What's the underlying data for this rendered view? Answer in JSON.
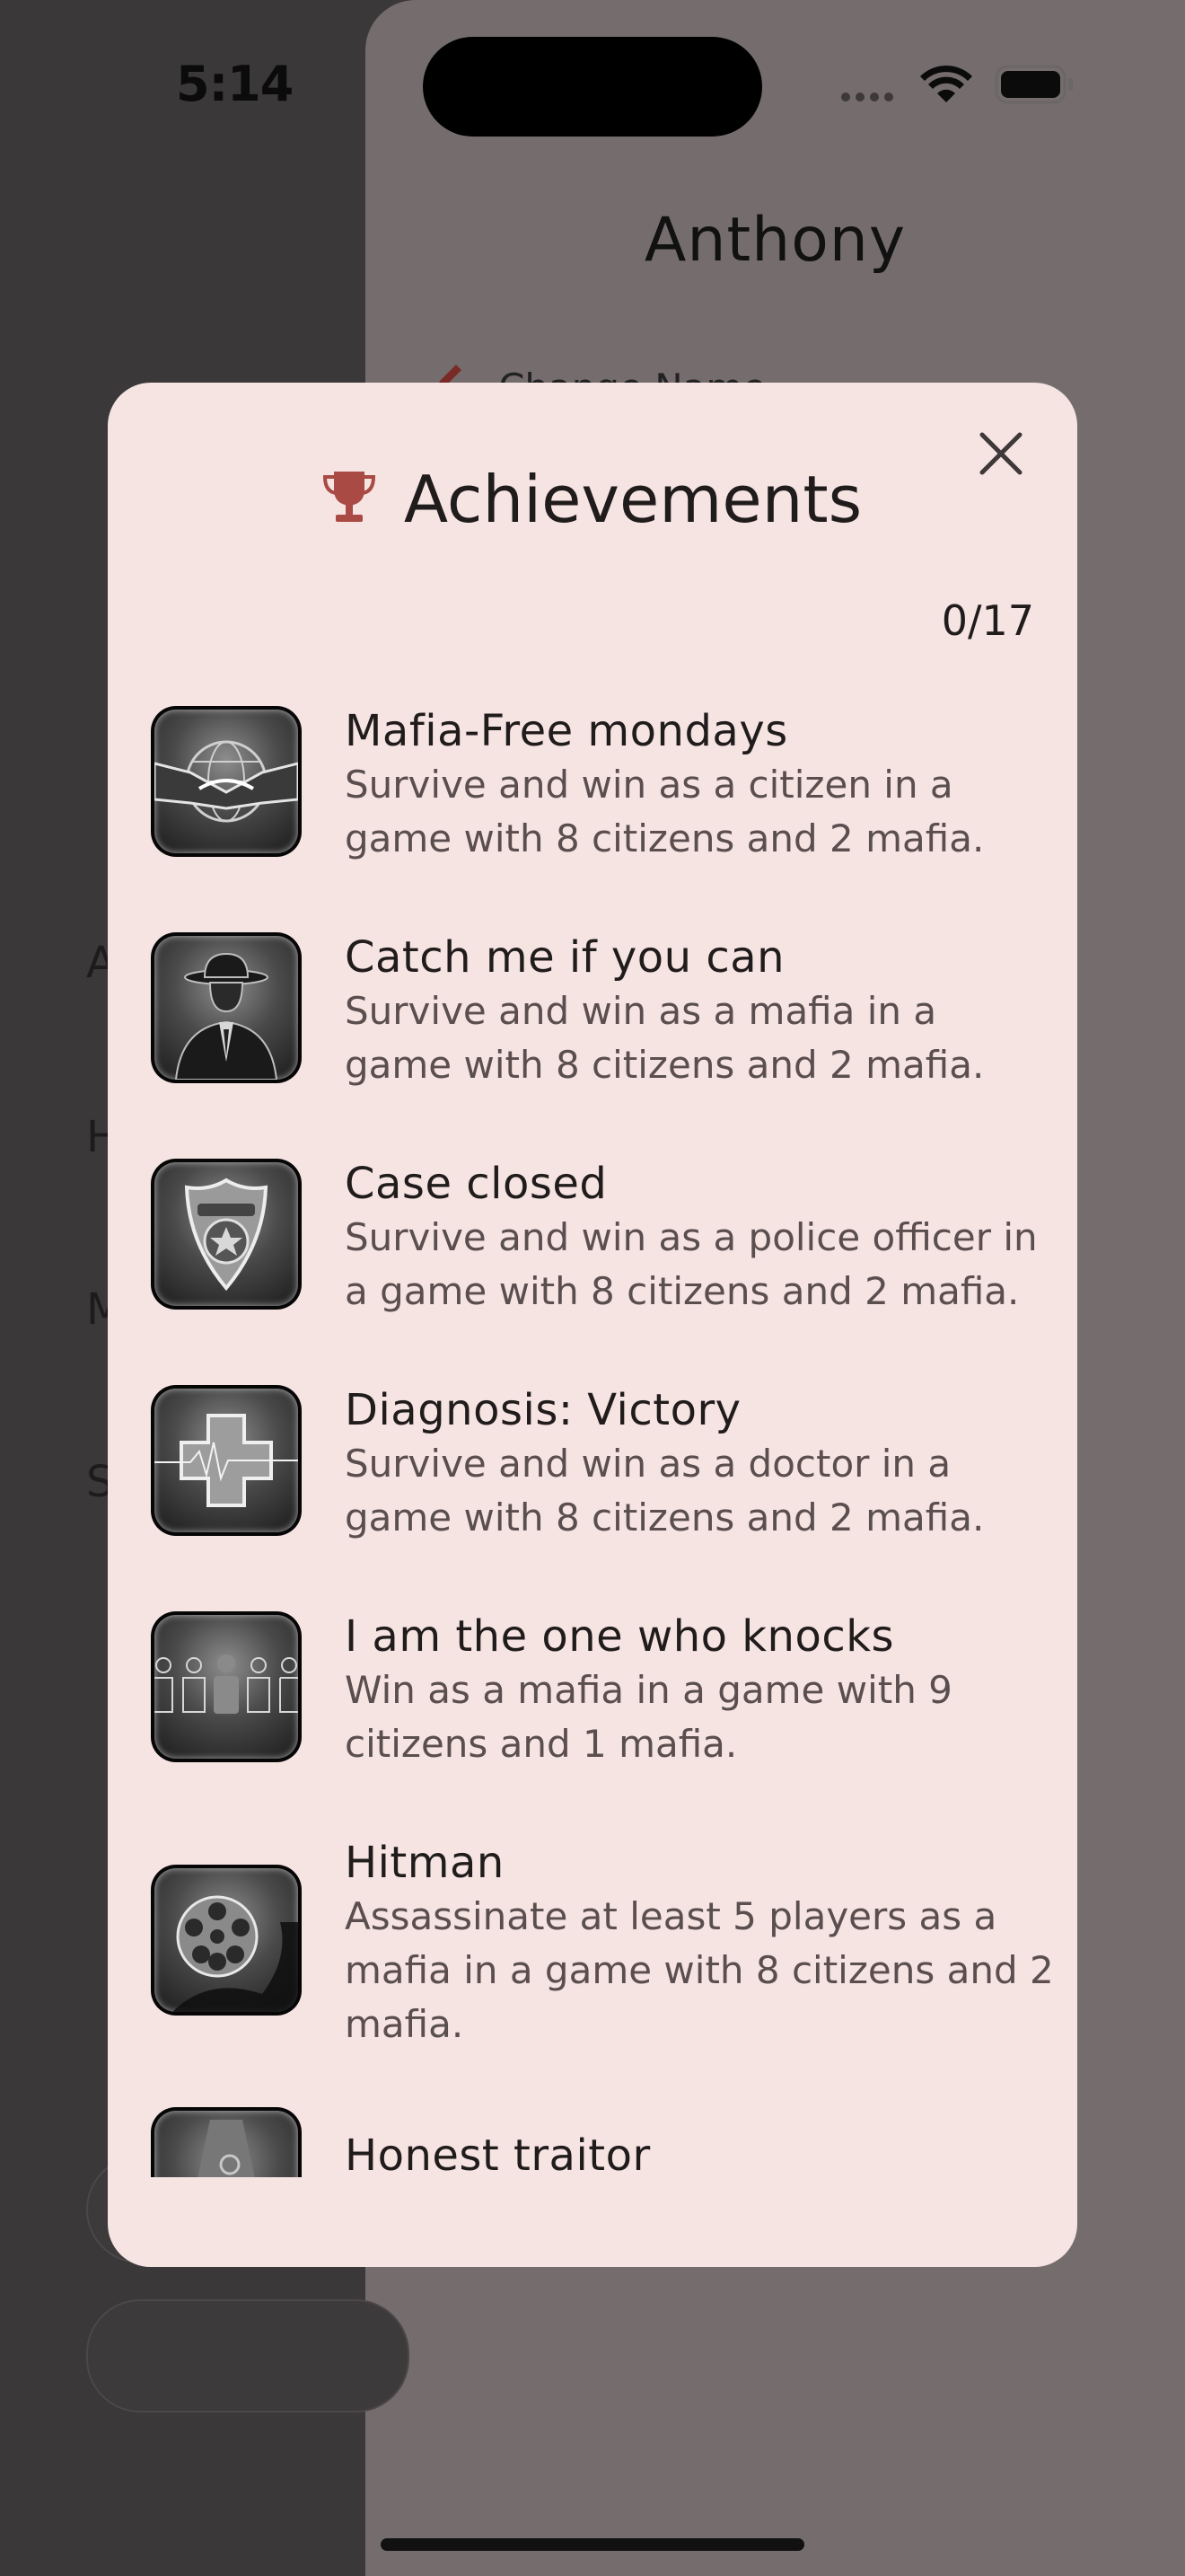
{
  "status_bar": {
    "time": "5:14"
  },
  "background": {
    "profile_name": "Anthony",
    "edit_label": "Change Name",
    "side_letters": [
      "A",
      "H",
      "M",
      "S"
    ]
  },
  "modal": {
    "title": "Achievements",
    "progress": "0/17",
    "achievements": [
      {
        "title": "Mafia-Free mondays",
        "description": "Survive and win as a citizen in a game with 8 citizens and 2 mafia.",
        "icon": "handshake-globe-icon"
      },
      {
        "title": "Catch me if you can",
        "description": "Survive and win as a mafia in a game with 8 citizens and 2 mafia.",
        "icon": "mafia-man-icon"
      },
      {
        "title": "Case closed",
        "description": "Survive and win as a police officer in a game with 8 citizens and 2 mafia.",
        "icon": "police-badge-icon"
      },
      {
        "title": "Diagnosis: Victory",
        "description": "Survive and win as a doctor in a game with 8 citizens and 2 mafia.",
        "icon": "medical-cross-icon"
      },
      {
        "title": "I am the one who knocks",
        "description": "Win as a mafia in a game with 9 citizens and 1 mafia.",
        "icon": "crowd-icon"
      },
      {
        "title": "Hitman",
        "description": "Assassinate at least 5 players as a mafia in a game with 8 citizens and 2 mafia.",
        "icon": "film-reel-icon"
      },
      {
        "title": "Honest traitor",
        "description": "",
        "icon": "spotlight-icon"
      }
    ]
  },
  "colors": {
    "modal_bg": "#f6e4e3",
    "accent": "#a94a44",
    "backdrop": "#3a3839",
    "pushed_sheet": "#756d6d"
  }
}
